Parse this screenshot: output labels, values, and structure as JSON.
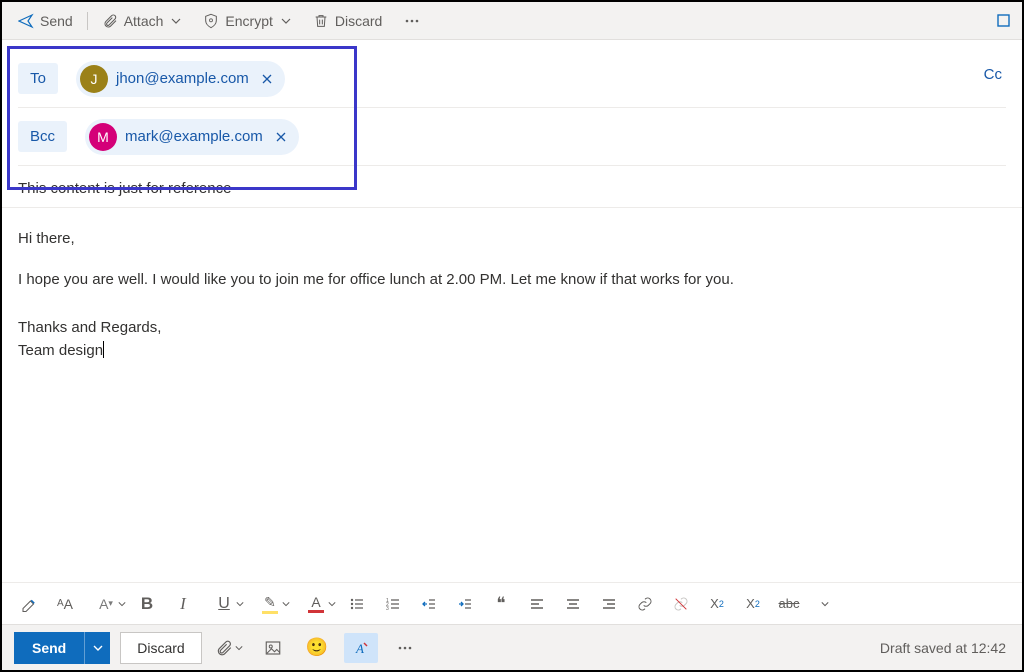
{
  "toolbar": {
    "send": "Send",
    "attach": "Attach",
    "encrypt": "Encrypt",
    "discard": "Discard"
  },
  "fields": {
    "to_label": "To",
    "bcc_label": "Bcc",
    "cc_label": "Cc",
    "to_pill": {
      "initial": "J",
      "email": "jhon@example.com"
    },
    "bcc_pill": {
      "initial": "M",
      "email": "mark@example.com"
    }
  },
  "subject": "This content is just for reference",
  "body": {
    "greeting": "Hi there,",
    "paragraph": "I hope you are well. I would like you to join me for office lunch at 2.00 PM. Let me know if that works for you.",
    "sig1": "Thanks and Regards,",
    "sig2": "Team design"
  },
  "fmt": {
    "bold": "B",
    "italic": "I",
    "underline": "U",
    "quote": "❝",
    "strike": "abc",
    "sup": "X",
    "sup2": "2",
    "sub": "X",
    "sub2": "2",
    "fontA": "A",
    "pencil": "✎"
  },
  "bottom": {
    "send": "Send",
    "discard": "Discard",
    "status": "Draft saved at 12:42"
  }
}
